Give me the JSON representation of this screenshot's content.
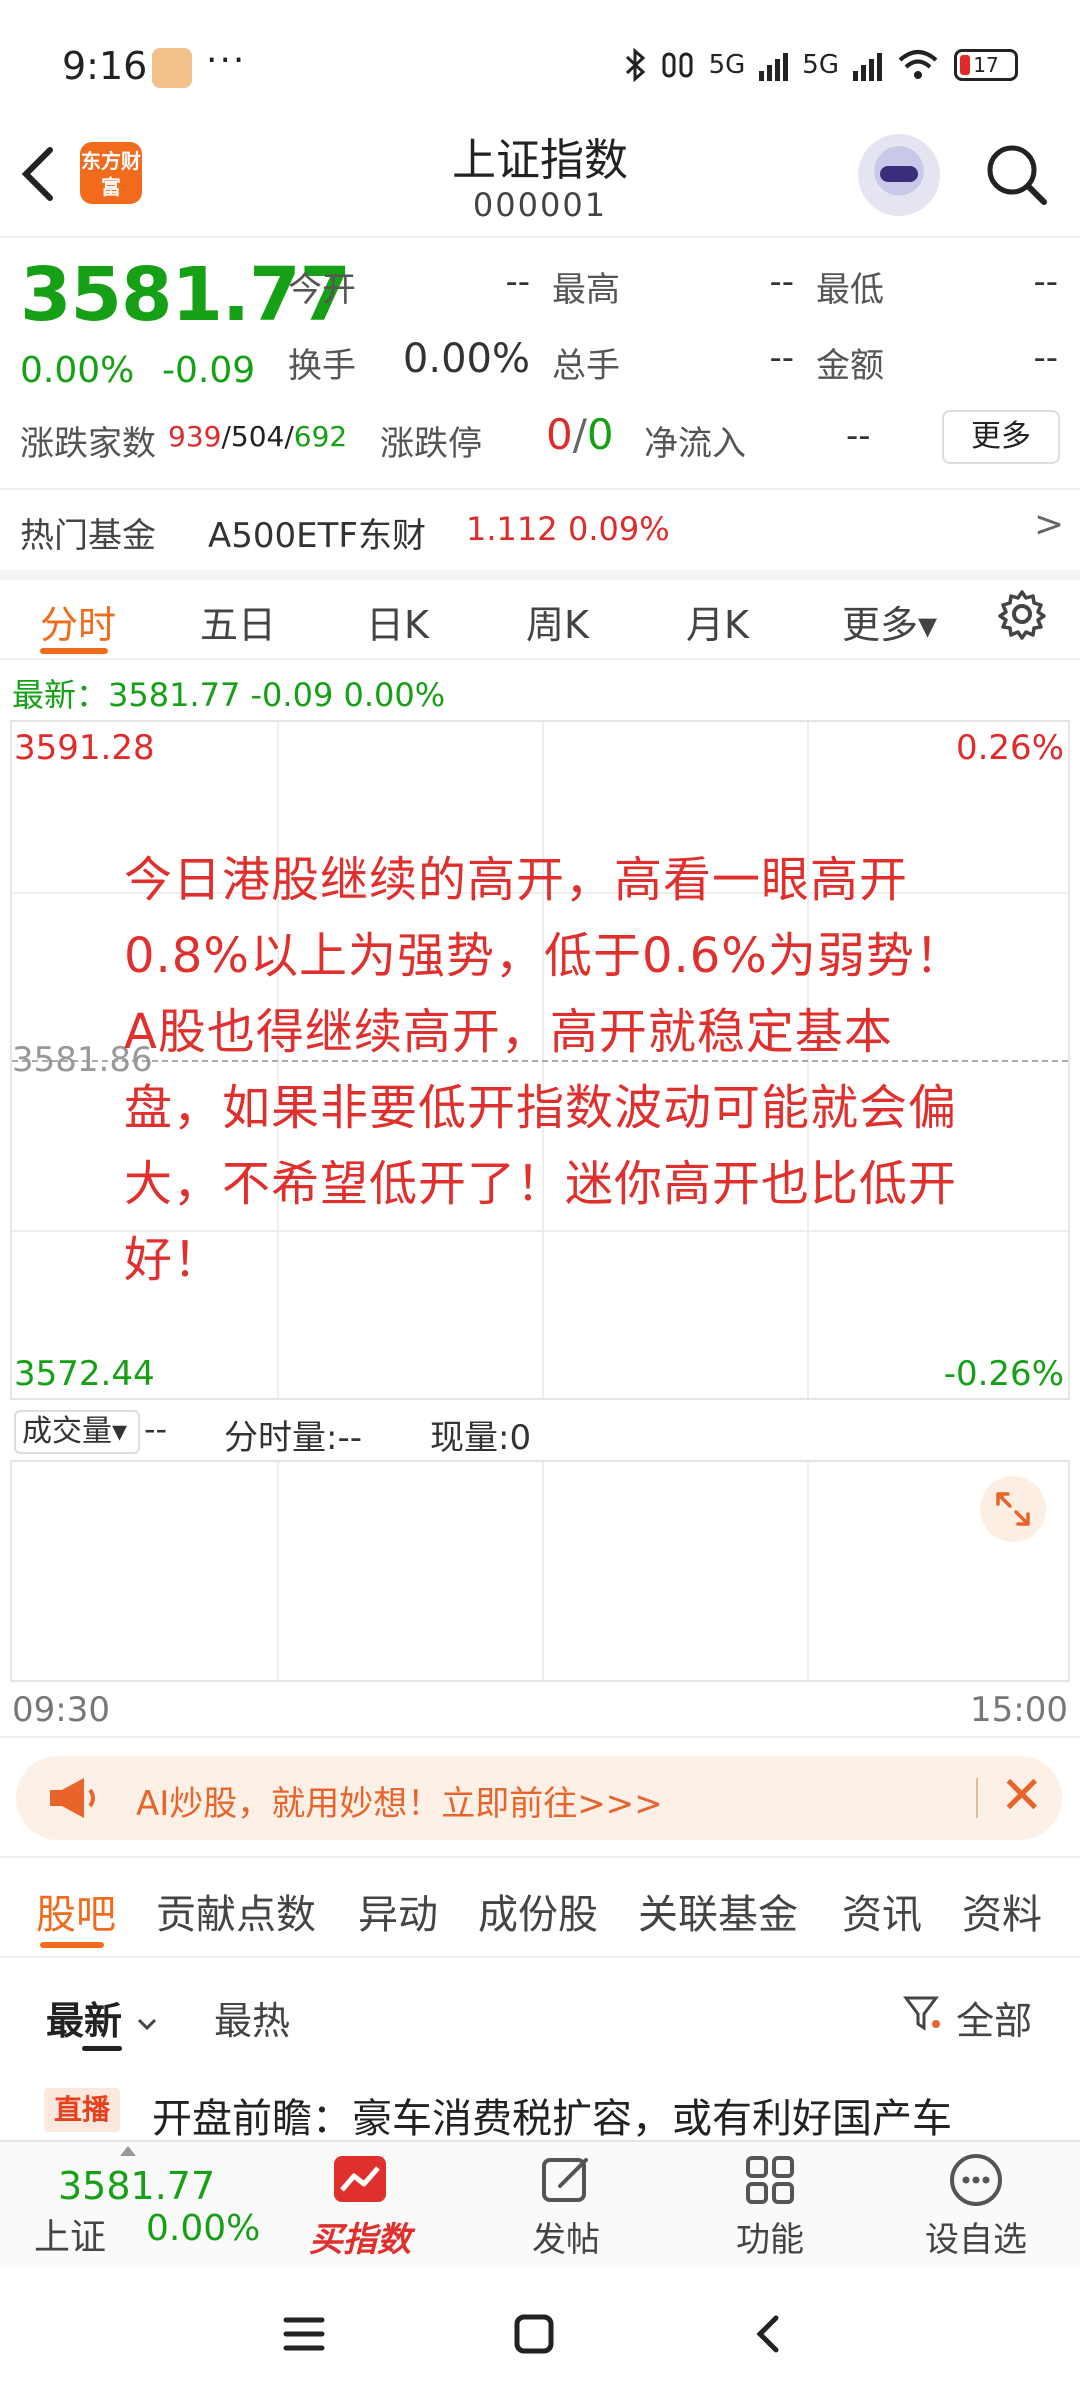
{
  "status_bar": {
    "time": "9:16",
    "dots": "···",
    "network_1": "5G",
    "network_2": "5G",
    "battery": "17"
  },
  "header": {
    "back_icon": "chevron-left-icon",
    "brand_logo_text": "东方财富",
    "title": "上证指数",
    "code": "000001",
    "search_icon": "search-icon"
  },
  "quote": {
    "price": "3581.77",
    "change_pct": "0.00%",
    "change": "-0.09",
    "open_label": "今开",
    "open_value": "--",
    "high_label": "最高",
    "high_value": "--",
    "low_label": "最低",
    "low_value": "--",
    "turnover_label": "换手",
    "turnover_value": "0.00%",
    "volume_label": "总手",
    "volume_value": "--",
    "amount_label": "金额",
    "amount_value": "--",
    "breadth_label": "涨跌家数",
    "breadth_up": "939",
    "breadth_flat": "504",
    "breadth_down": "692",
    "limit_label": "涨跌停",
    "limit_up": "0",
    "limit_down": "0",
    "inflow_label": "净流入",
    "inflow_value": "--",
    "more_button": "更多"
  },
  "hot_fund": {
    "label": "热门基金",
    "name": "A500ETF东财",
    "price": "1.112",
    "pct": "0.09%",
    "arrow": ">"
  },
  "chart_tabs": [
    "分时",
    "五日",
    "日K",
    "周K",
    "月K",
    "更多▾"
  ],
  "latest": "最新：3581.77  -0.09  0.00%",
  "chart": {
    "high": "3591.28",
    "high_pct": "0.26%",
    "mid": "3581.86",
    "low": "3572.44",
    "low_pct": "-0.26%",
    "start_time": "09:30",
    "end_time": "15:00"
  },
  "overlay_text": "今日港股继续的高开，高看一眼高开0.8%以上为强势，低于0.6%为弱势！A股也得继续高开，高开就稳定基本盘，如果非要低开指数波动可能就会偏大，不希望低开了！迷你高开也比低开好！",
  "volume": {
    "select": "成交量▾",
    "dash": "--",
    "minute": "分时量:--",
    "now": "现量:0"
  },
  "promo": {
    "text": "AI炒股，就用妙想！立即前往>>>",
    "close": "✕"
  },
  "sub_tabs": [
    "股吧",
    "贡献点数",
    "异动",
    "成份股",
    "关联基金",
    "资讯",
    "资料"
  ],
  "sort": {
    "newest": "最新",
    "hot": "最热",
    "filter": "全部"
  },
  "news": {
    "badge": "直播",
    "title": "开盘前瞻：豪车消费税扩容，或有利好国产车"
  },
  "bottom_bar": {
    "price": "3581.77",
    "label": "上证",
    "pct": "0.00%",
    "buy": "买指数",
    "post": "发帖",
    "functions": "功能",
    "watchlist": "设自选"
  },
  "colors": {
    "up": "#e02b2b",
    "down": "#16a016",
    "accent": "#f26b1d"
  }
}
